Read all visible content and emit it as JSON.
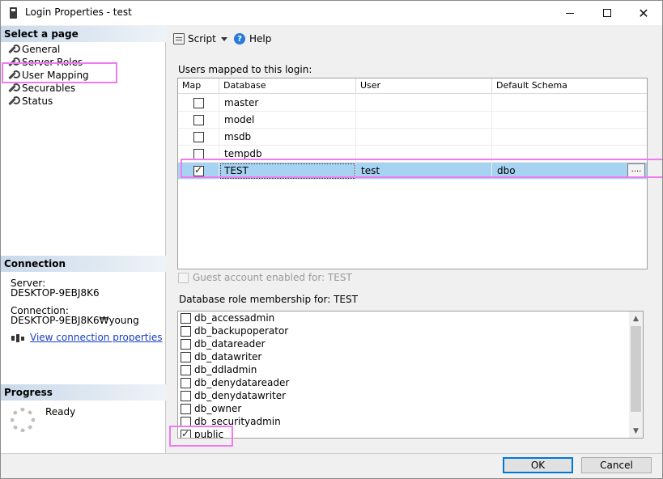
{
  "window": {
    "title": "Login Properties - test"
  },
  "left_panel": {
    "select_page_header": "Select a page",
    "pages": [
      {
        "label": "General"
      },
      {
        "label": "Server Roles"
      },
      {
        "label": "User Mapping"
      },
      {
        "label": "Securables"
      },
      {
        "label": "Status"
      }
    ],
    "connection_header": "Connection",
    "server_label": "Server:",
    "server_value": "DESKTOP-9EBJ8K6",
    "connection_label": "Connection:",
    "connection_value": "DESKTOP-9EBJ8K6₩young",
    "view_connection_link": "View connection properties",
    "progress_header": "Progress",
    "progress_status": "Ready"
  },
  "toolbar": {
    "script_label": "Script",
    "help_label": "Help"
  },
  "users_mapped": {
    "label": "Users mapped to this login:",
    "columns": [
      "Map",
      "Database",
      "User",
      "Default Schema"
    ],
    "rows": [
      {
        "map": false,
        "database": "master",
        "user": "",
        "schema": ""
      },
      {
        "map": false,
        "database": "model",
        "user": "",
        "schema": ""
      },
      {
        "map": false,
        "database": "msdb",
        "user": "",
        "schema": ""
      },
      {
        "map": false,
        "database": "tempdb",
        "user": "",
        "schema": ""
      },
      {
        "map": true,
        "database": "TEST",
        "user": "test",
        "schema": "dbo",
        "button": "...."
      }
    ]
  },
  "guest_account": {
    "label": "Guest account enabled for: TEST",
    "enabled": false
  },
  "role_membership": {
    "label": "Database role membership for: TEST",
    "roles": [
      {
        "name": "db_accessadmin",
        "checked": false
      },
      {
        "name": "db_backupoperator",
        "checked": false
      },
      {
        "name": "db_datareader",
        "checked": false
      },
      {
        "name": "db_datawriter",
        "checked": false
      },
      {
        "name": "db_ddladmin",
        "checked": false
      },
      {
        "name": "db_denydatareader",
        "checked": false
      },
      {
        "name": "db_denydatawriter",
        "checked": false
      },
      {
        "name": "db_owner",
        "checked": false
      },
      {
        "name": "db_securityadmin",
        "checked": false
      },
      {
        "name": "public",
        "checked": true
      }
    ]
  },
  "buttons": {
    "ok": "OK",
    "cancel": "Cancel"
  },
  "colors": {
    "highlight": "#f07af0",
    "selected_row": "#a7d3f2",
    "link": "#1a3fc4",
    "section_header": "#c9d9ea"
  }
}
